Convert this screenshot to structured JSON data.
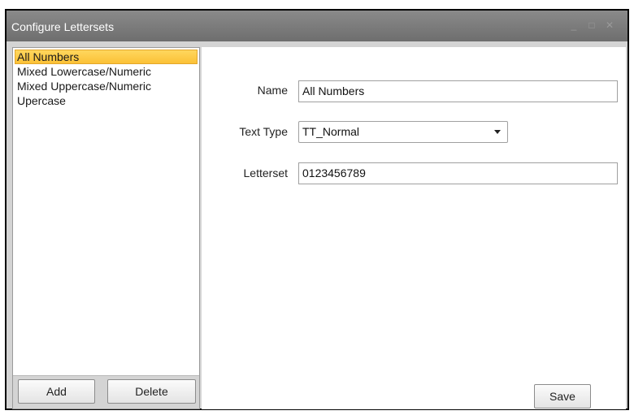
{
  "window": {
    "title": "Configure Lettersets",
    "controls": [
      "minimize-icon",
      "maximize-icon",
      "close-icon"
    ]
  },
  "sidebar": {
    "items": [
      {
        "label": "All Numbers",
        "selected": true
      },
      {
        "label": "Mixed Lowercase/Numeric",
        "selected": false
      },
      {
        "label": "Mixed Uppercase/Numeric",
        "selected": false
      },
      {
        "label": "Upercase",
        "selected": false
      }
    ],
    "add_label": "Add",
    "delete_label": "Delete"
  },
  "form": {
    "name_label": "Name",
    "name_value": "All Numbers",
    "text_type_label": "Text Type",
    "text_type_value": "TT_Normal",
    "letterset_label": "Letterset",
    "letterset_value": "0123456789",
    "save_label": "Save"
  },
  "colors": {
    "titlebar": "#7c7c7c",
    "selection": "#fbc136",
    "client_bg": "#d4d4d4"
  }
}
